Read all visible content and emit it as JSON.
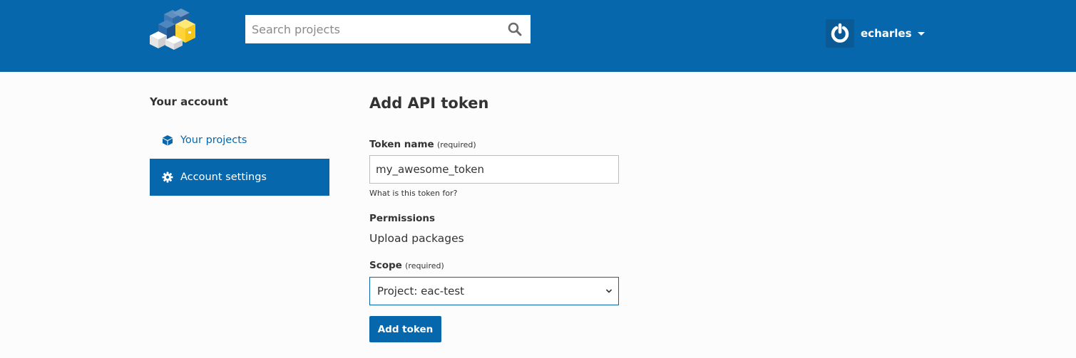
{
  "header": {
    "search": {
      "placeholder": "Search projects",
      "value": ""
    },
    "user": {
      "name": "echarles"
    },
    "colors": {
      "brand": "#0767ad"
    }
  },
  "sidebar": {
    "heading": "Your account",
    "items": [
      {
        "label": "Your projects",
        "icon": "cube-icon",
        "active": false
      },
      {
        "label": "Account settings",
        "icon": "gear-icon",
        "active": true
      }
    ]
  },
  "main": {
    "title": "Add API token",
    "token_name": {
      "label": "Token name",
      "required": "(required)",
      "value": "my_awesome_token",
      "help": "What is this token for?"
    },
    "permissions": {
      "label": "Permissions",
      "value": "Upload packages"
    },
    "scope": {
      "label": "Scope",
      "required": "(required)",
      "selected": "Project: eac-test"
    },
    "submit_label": "Add token"
  }
}
